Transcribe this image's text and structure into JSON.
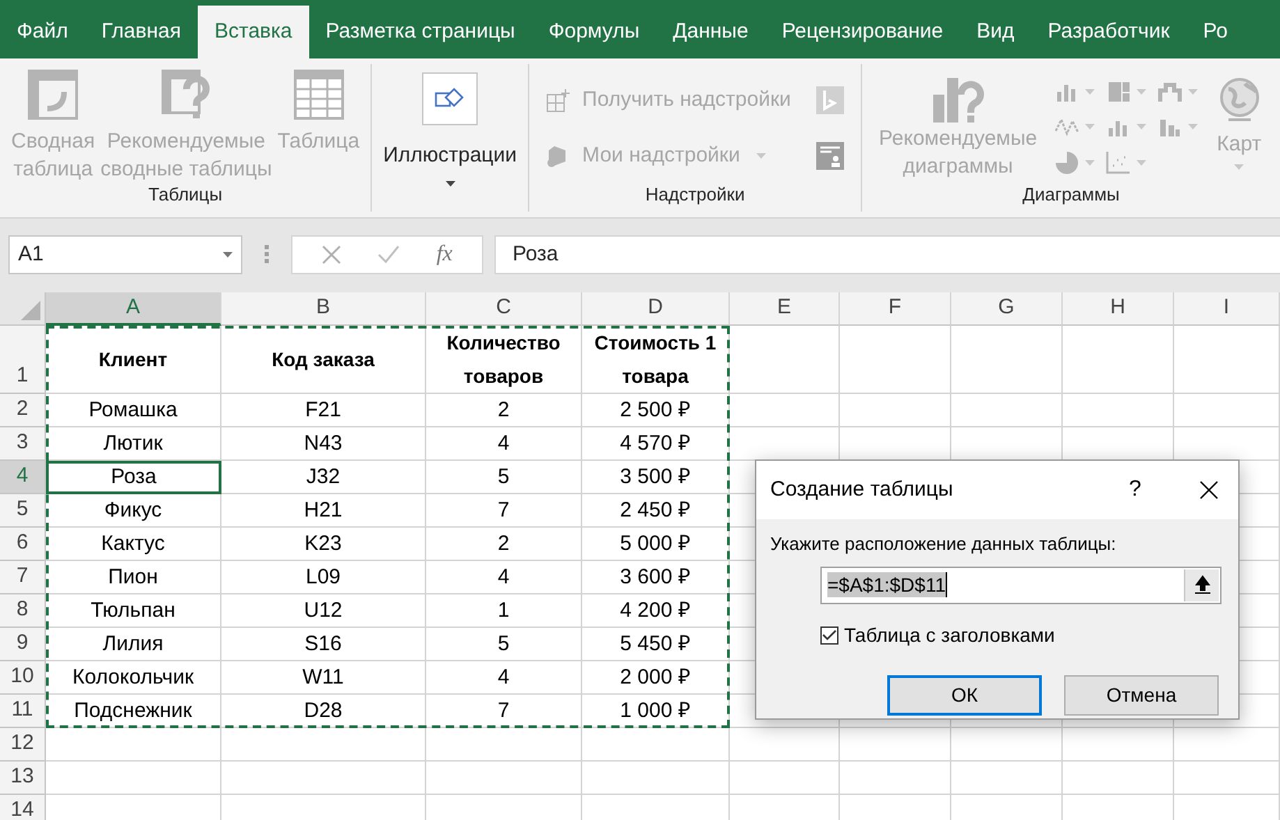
{
  "tabs": [
    {
      "label": "Файл",
      "selected": false
    },
    {
      "label": "Главная",
      "selected": false
    },
    {
      "label": "Вставка",
      "selected": true
    },
    {
      "label": "Разметка страницы",
      "selected": false
    },
    {
      "label": "Формулы",
      "selected": false
    },
    {
      "label": "Данные",
      "selected": false
    },
    {
      "label": "Рецензирование",
      "selected": false
    },
    {
      "label": "Вид",
      "selected": false
    },
    {
      "label": "Разработчик",
      "selected": false
    },
    {
      "label": "Ро",
      "selected": false
    }
  ],
  "ribbon": [
    {
      "kind": "large",
      "label": "Таблицы",
      "buttons": [
        {
          "lines": [
            "Сводная",
            "таблица"
          ],
          "disabled": true
        },
        {
          "lines": [
            "Рекомендуемые",
            "сводные таблицы"
          ],
          "disabled": true
        },
        {
          "lines": [
            "Таблица"
          ],
          "disabled": true
        }
      ]
    },
    {
      "kind": "dropdown",
      "buttons": [
        {
          "lines": [
            "Иллюстрации"
          ],
          "disabled": false
        }
      ]
    },
    {
      "kind": "list",
      "label": "Надстройки",
      "buttons": [
        {
          "lines": [
            "Получить надстройки"
          ],
          "disabled": true
        },
        {
          "lines": [
            "Мои надстройки"
          ],
          "disabled": true
        }
      ]
    },
    {
      "kind": "charts",
      "label": "Диаграммы",
      "buttons": [
        {
          "lines": [
            "Рекомендуемые",
            "диаграммы"
          ],
          "disabled": true
        },
        {
          "lines": [
            "Карт"
          ],
          "disabled": true
        }
      ]
    }
  ],
  "formula_bar": {
    "name_box": "A1",
    "function_label": "fx",
    "value": "Роза"
  },
  "columns": [
    {
      "label": "A",
      "selected": true
    },
    {
      "label": "B",
      "selected": false
    },
    {
      "label": "C",
      "selected": false
    },
    {
      "label": "D",
      "selected": false
    },
    {
      "label": "E",
      "selected": false
    },
    {
      "label": "F",
      "selected": false
    },
    {
      "label": "G",
      "selected": false
    },
    {
      "label": "H",
      "selected": false
    },
    {
      "label": "I",
      "selected": false
    }
  ],
  "rows": [
    {
      "number": "1",
      "selected": false,
      "cells": [
        "Клиент",
        "Код заказа",
        "Количество товаров",
        "Стоимость 1 товара"
      ]
    },
    {
      "number": "2",
      "selected": false,
      "cells": [
        "Ромашка",
        "F21",
        "2",
        "2 500 ₽"
      ]
    },
    {
      "number": "3",
      "selected": false,
      "cells": [
        "Лютик",
        "N43",
        "4",
        "4 570 ₽"
      ]
    },
    {
      "number": "4",
      "selected": true,
      "cells": [
        "Роза",
        "J32",
        "5",
        "3 500 ₽"
      ]
    },
    {
      "number": "5",
      "selected": false,
      "cells": [
        "Фикус",
        "H21",
        "7",
        "2 450 ₽"
      ]
    },
    {
      "number": "6",
      "selected": false,
      "cells": [
        "Кактус",
        "K23",
        "2",
        "5 000 ₽"
      ]
    },
    {
      "number": "7",
      "selected": false,
      "cells": [
        "Пион",
        "L09",
        "4",
        "3 600 ₽"
      ]
    },
    {
      "number": "8",
      "selected": false,
      "cells": [
        "Тюльпан",
        "U12",
        "1",
        "4 200 ₽"
      ]
    },
    {
      "number": "9",
      "selected": false,
      "cells": [
        "Лилия",
        "S16",
        "5",
        "5 450 ₽"
      ]
    },
    {
      "number": "10",
      "selected": false,
      "cells": [
        "Колокольчик",
        "W11",
        "4",
        "2 000 ₽"
      ]
    },
    {
      "number": "11",
      "selected": false,
      "cells": [
        "Подснежник",
        "D28",
        "7",
        "1 000 ₽"
      ]
    },
    {
      "number": "12",
      "selected": false
    },
    {
      "number": "13",
      "selected": false
    },
    {
      "number": "14",
      "selected": false
    }
  ],
  "dialog": {
    "title": "Создание таблицы",
    "help": "?",
    "prompt": "Укажите расположение данных таблицы:",
    "range": "=$A$1:$D$11",
    "checkbox": {
      "label": "Таблица с заголовками",
      "checked": true
    },
    "buttons": [
      {
        "label": "ОК",
        "selected": true
      },
      {
        "label": "Отмена",
        "selected": false
      }
    ]
  }
}
